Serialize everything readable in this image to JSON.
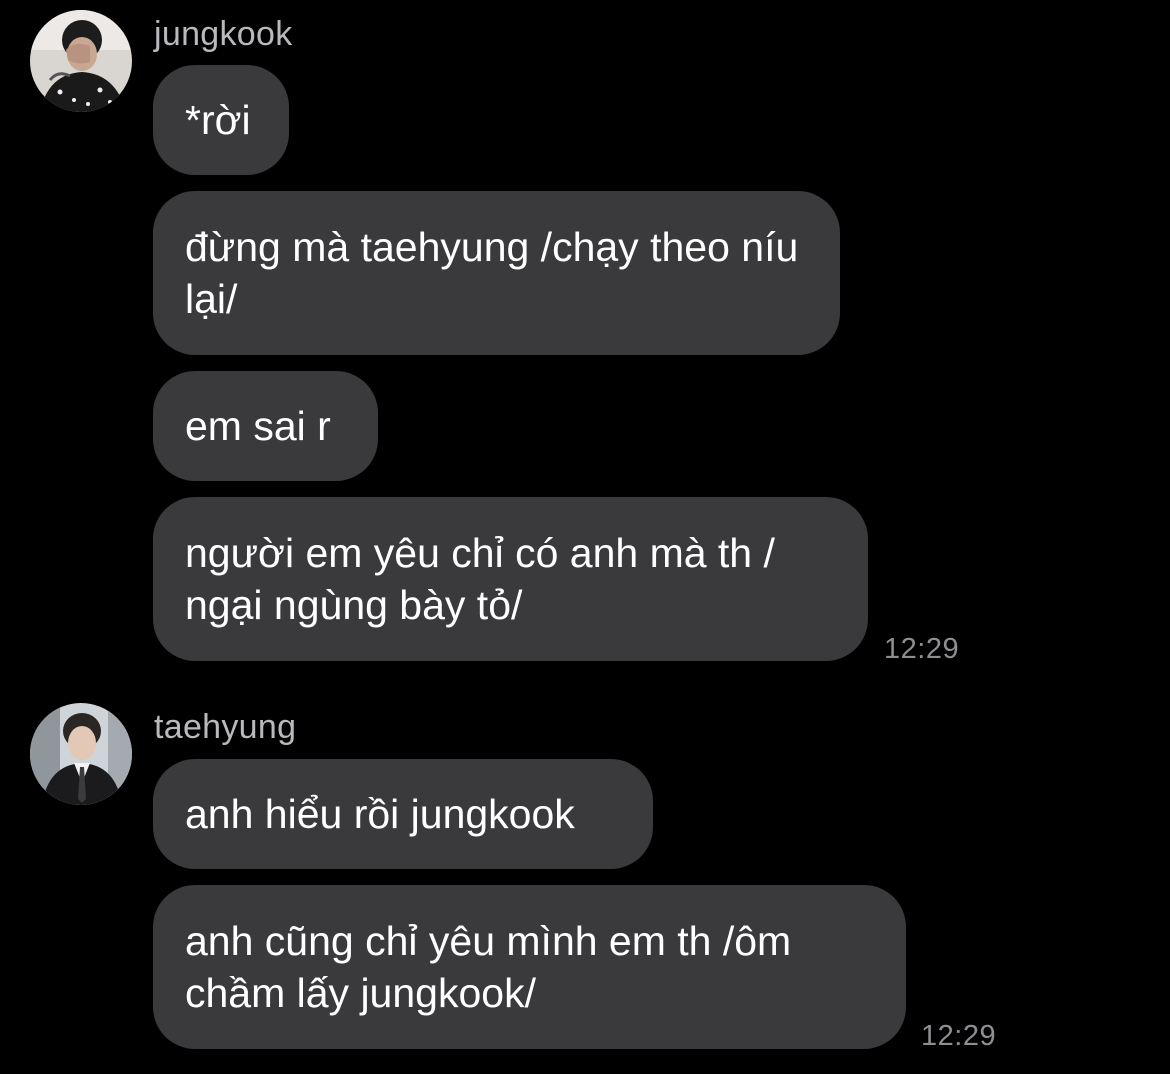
{
  "colors": {
    "background": "#000000",
    "bubble": "#3a3a3c",
    "sender_name": "#b8b8bd",
    "timestamp": "#8e8e93"
  },
  "groups": [
    {
      "sender": "jungkook",
      "avatar_icon": "jungkook-avatar",
      "messages": [
        "*rời",
        "đừng mà taehyung /chạy theo níu lại/",
        "em sai r",
        "người em yêu chỉ có anh mà th / ngại ngùng bày tỏ/"
      ],
      "time": "12:29"
    },
    {
      "sender": "taehyung",
      "avatar_icon": "taehyung-avatar",
      "messages": [
        "anh hiểu rồi jungkook",
        "anh cũng chỉ yêu mình em th /ôm chầm lấy jungkook/"
      ],
      "time": "12:29"
    }
  ]
}
